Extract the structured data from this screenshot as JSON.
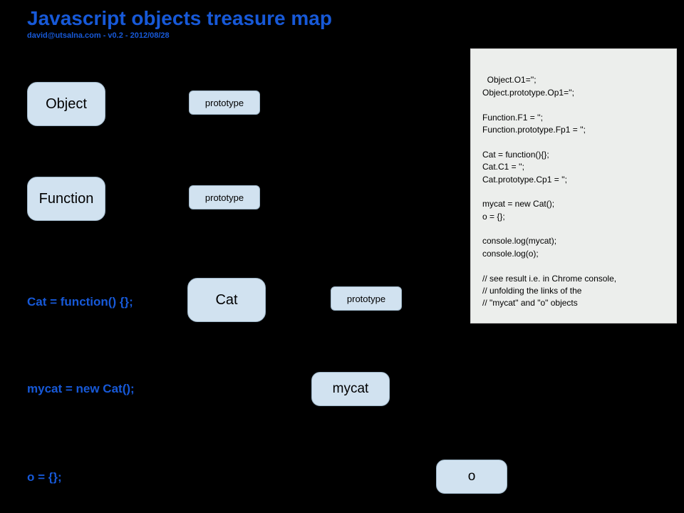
{
  "header": {
    "title": "Javascript objects treasure map",
    "subtitle": "david@utsalna.com - v0.2 - 2012/08/28"
  },
  "nodes": {
    "object_label": "Object",
    "object_proto_label": "prototype",
    "function_label": "Function",
    "function_proto_label": "prototype",
    "cat_label": "Cat",
    "cat_proto_label": "prototype",
    "mycat_label": "mycat",
    "o_label": "o"
  },
  "captions": {
    "cat_def": "Cat = function() {};",
    "mycat_def": "mycat = new Cat();",
    "o_def": "o = {};"
  },
  "code": "Object.O1='';\nObject.prototype.Op1='';\n\nFunction.F1 = '';\nFunction.prototype.Fp1 = '';\n\nCat = function(){};\nCat.C1 = '';\nCat.prototype.Cp1 = '';\n\nmycat = new Cat();\no = {};\n\nconsole.log(mycat);\nconsole.log(o);\n\n// see result i.e. in Chrome console,\n// unfolding the links of the\n// \"mycat\" and \"o\" objects"
}
